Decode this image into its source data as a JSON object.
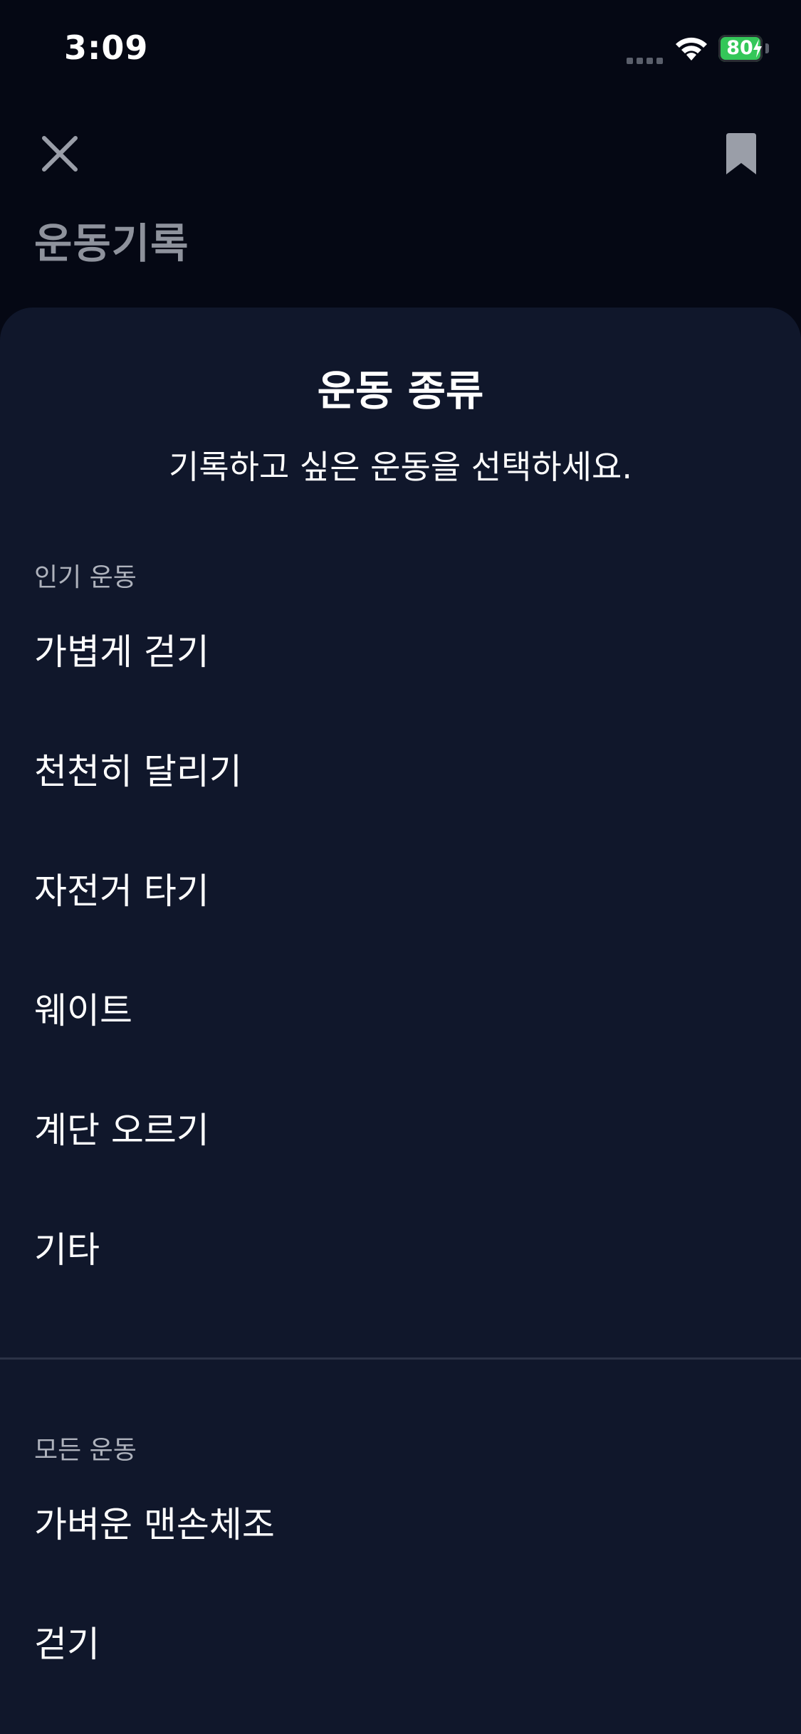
{
  "status_bar": {
    "time": "3:09",
    "battery": "80",
    "battery_color": "#34c759"
  },
  "header": {
    "title": "운동기록",
    "close_icon": "close-icon",
    "bookmark_icon": "bookmark-icon"
  },
  "sheet": {
    "title": "운동 종류",
    "subtitle": "기록하고 싶은 운동을 선택하세요.",
    "popular": {
      "header": "인기 운동",
      "items": [
        {
          "label": "가볍게 걷기"
        },
        {
          "label": "천천히 달리기"
        },
        {
          "label": "자전거 타기"
        },
        {
          "label": "웨이트"
        },
        {
          "label": "계단 오르기"
        },
        {
          "label": "기타"
        }
      ]
    },
    "all": {
      "header": "모든 운동",
      "items": [
        {
          "label": "가벼운 맨손체조"
        },
        {
          "label": "걷기"
        }
      ]
    }
  },
  "colors": {
    "background": "#050814",
    "sheet_background": "#10172b",
    "muted_text": "#aeb2bc"
  }
}
